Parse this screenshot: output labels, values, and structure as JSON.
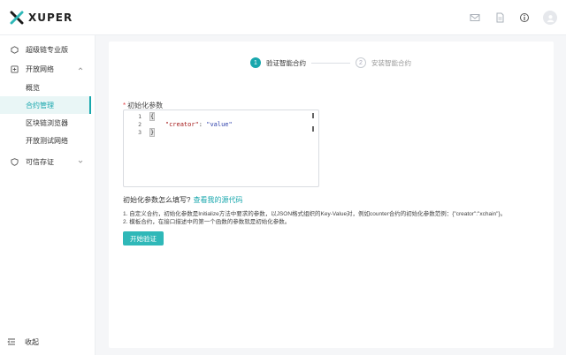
{
  "header": {
    "logo_text": "XUPER",
    "icons": [
      "mail-icon",
      "document-icon",
      "info-icon",
      "user-avatar-icon"
    ]
  },
  "sidebar": {
    "items": [
      {
        "label": "超级链专业版",
        "icon": "hexagon-icon"
      },
      {
        "label": "开放网络",
        "icon": "network-icon",
        "expanded": true,
        "children": [
          {
            "label": "概览"
          },
          {
            "label": "合约管理",
            "active": true
          },
          {
            "label": "区块链浏览器"
          },
          {
            "label": "开放测试网络"
          }
        ]
      },
      {
        "label": "可信存证",
        "icon": "shield-icon",
        "expanded": false
      }
    ],
    "collapse_label": "收起"
  },
  "steps": [
    {
      "number": "1",
      "label": "验证智能合约",
      "active": true
    },
    {
      "number": "2",
      "label": "安装智能合约",
      "active": false
    }
  ],
  "form": {
    "required_mark": "*",
    "init_params_label": "初始化参数",
    "editor_lines": [
      {
        "n": "1",
        "text": "{"
      },
      {
        "n": "2",
        "key": "\"creator\"",
        "sep": ": ",
        "value": "\"value\""
      },
      {
        "n": "3",
        "text": "}"
      }
    ],
    "help_question": "初始化参数怎么填写?",
    "help_link": "查看我的源代码",
    "notes": [
      "1. 自定义合约，初始化参数是Initialize方法中要求的参数，以JSON格式组织的Key-Value对，例如counter合约的初始化参数范例：{\"creator\":\"xchain\"}。",
      "2. 模板合约，在接口描述中的第一个函数的参数就是初始化参数。"
    ],
    "submit_label": "开始验证"
  },
  "colors": {
    "accent": "#19a7ad",
    "button": "#2fb8b8",
    "required": "#e5484d"
  }
}
